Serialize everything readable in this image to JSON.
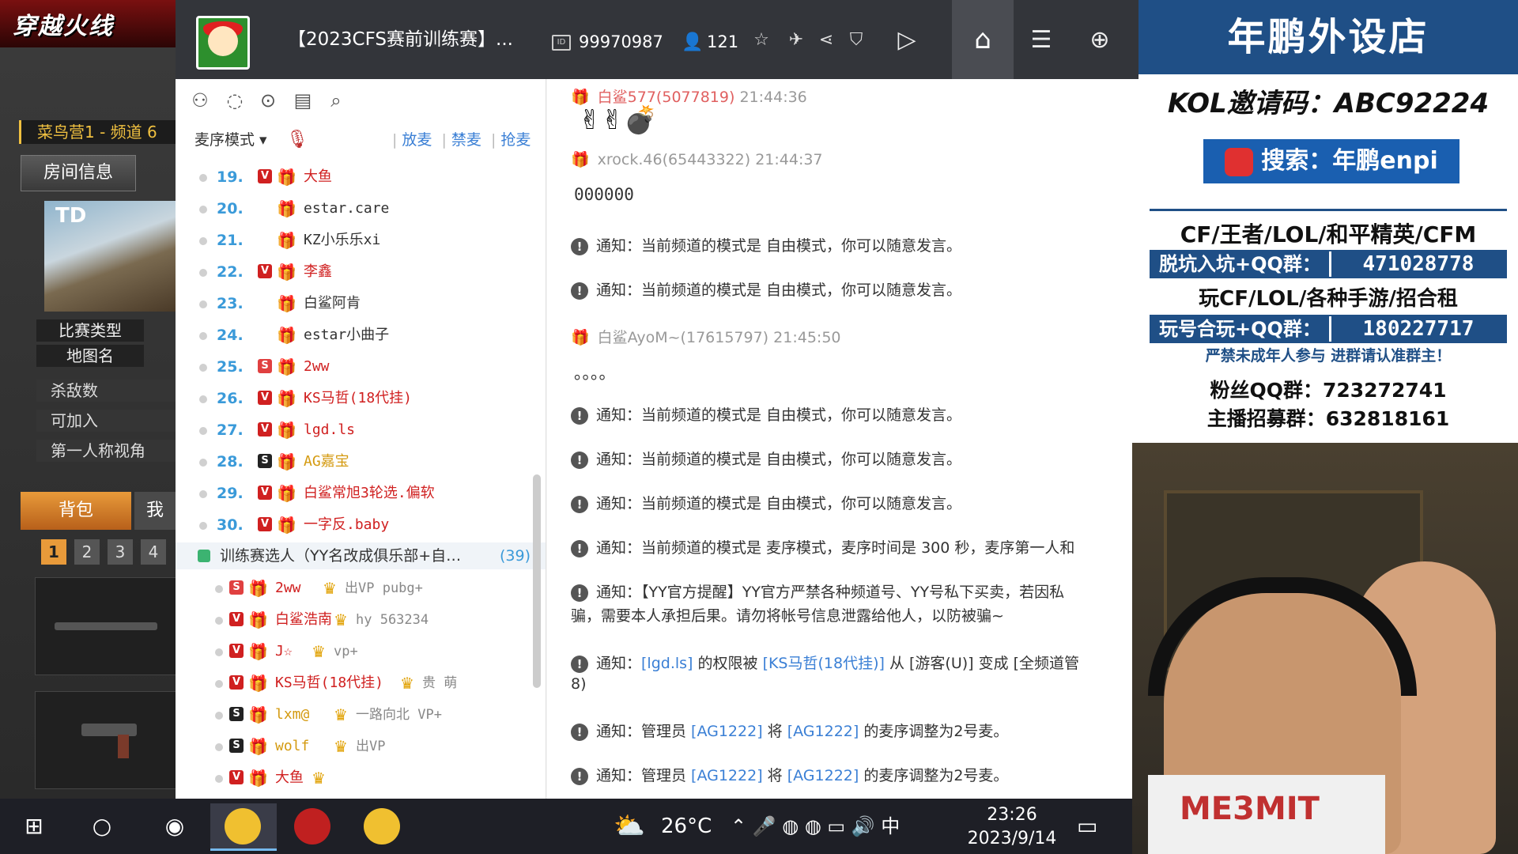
{
  "game": {
    "logo": "穿越火线",
    "channel": "菜鸟营1 - 频道 6",
    "room_info_label": "房间信息",
    "map_code": "TD",
    "match_type_label": "比赛类型",
    "map_name_label": "地图名",
    "kills_label": "杀敌数",
    "joinable_label": "可加入",
    "first_person_label": "第一人称视角",
    "bag_label": "背包",
    "me_label": "我",
    "slots": [
      "1",
      "2",
      "3",
      "4"
    ]
  },
  "yy": {
    "channel_title": "【2023CFS赛前训练赛】...",
    "channel_id": "99970987",
    "online_count": "121",
    "member_panel": {
      "mode_label": "麦序模式",
      "actions": [
        "放麦",
        "禁麦",
        "抢麦"
      ],
      "rows": [
        {
          "num": "19.",
          "badge": "V",
          "badge_color": "#d02020",
          "gift": "gold",
          "name": "大鱼",
          "name_color": "red"
        },
        {
          "num": "20.",
          "badge": "",
          "badge_color": "",
          "gift": "gold",
          "name": "estar.care",
          "name_color": "normal"
        },
        {
          "num": "21.",
          "badge": "",
          "badge_color": "",
          "gift": "gold",
          "name": "KZ小乐乐xi",
          "name_color": "normal"
        },
        {
          "num": "22.",
          "badge": "V",
          "badge_color": "#d02020",
          "gift": "gold",
          "name": "李鑫",
          "name_color": "red"
        },
        {
          "num": "23.",
          "badge": "",
          "badge_color": "",
          "gift": "gold",
          "name": "白鲨阿肯",
          "name_color": "normal"
        },
        {
          "num": "24.",
          "badge": "",
          "badge_color": "",
          "gift": "gold",
          "name": "estar小曲子",
          "name_color": "normal"
        },
        {
          "num": "25.",
          "badge": "S",
          "badge_color": "#e04040",
          "gift": "gold",
          "name": "2ww",
          "name_color": "red"
        },
        {
          "num": "26.",
          "badge": "V",
          "badge_color": "#d02020",
          "gift": "purple",
          "name": "KS马哲(18代挂)",
          "name_color": "red"
        },
        {
          "num": "27.",
          "badge": "V",
          "badge_color": "#d02020",
          "gift": "gold",
          "name": "lgd.ls",
          "name_color": "red"
        },
        {
          "num": "28.",
          "badge": "S",
          "badge_color": "#222222",
          "gift": "gold",
          "name": "AG嘉宝",
          "name_color": "gold"
        },
        {
          "num": "29.",
          "badge": "V",
          "badge_color": "#d02020",
          "gift": "gold",
          "name": "白鲨常旭3轮选.偏软",
          "name_color": "red"
        },
        {
          "num": "30.",
          "badge": "V",
          "badge_color": "#d02020",
          "gift": "gold",
          "name": "一字反.baby",
          "name_color": "red"
        }
      ],
      "group": {
        "name": "训练赛选人（YY名改成俱乐部+自…",
        "count": "(39)"
      },
      "sub_rows": [
        {
          "badge": "S",
          "badge_color": "#e04040",
          "gift": "gold",
          "name": "2ww",
          "name_color": "red",
          "extra": "出VP pubg+"
        },
        {
          "badge": "V",
          "badge_color": "#d02020",
          "gift": "gold",
          "name": "白鲨浩南",
          "name_color": "red",
          "extra": "hy 563234"
        },
        {
          "badge": "V",
          "badge_color": "#d02020",
          "gift": "gold",
          "name": "J☆",
          "name_color": "red",
          "extra": "vp+"
        },
        {
          "badge": "V",
          "badge_color": "#d02020",
          "gift": "purple",
          "name": "KS马哲(18代挂)",
          "name_color": "red",
          "extra": "贵 萌"
        },
        {
          "badge": "S",
          "badge_color": "#222222",
          "gift": "gold",
          "name": "lxm@",
          "name_color": "gold",
          "extra": "一路向北 VP+"
        },
        {
          "badge": "S",
          "badge_color": "#222222",
          "gift": "gold",
          "name": "wolf",
          "name_color": "gold",
          "extra": "出VP"
        },
        {
          "badge": "V",
          "badge_color": "#d02020",
          "gift": "gold",
          "name": "大鱼",
          "name_color": "red",
          "extra": ""
        }
      ]
    },
    "chat": {
      "messages": [
        {
          "type": "sender",
          "name": "白鲨577(5077819)",
          "time": "21:44:36",
          "red": true
        },
        {
          "type": "emoji",
          "text": "✌✌💣"
        },
        {
          "type": "sender",
          "name": "xrock.46(65443322)",
          "time": "21:44:37",
          "red": false
        },
        {
          "type": "body",
          "text": "000000"
        },
        {
          "type": "notice",
          "text": "通知：当前频道的模式是 自由模式，你可以随意发言。"
        },
        {
          "type": "notice",
          "text": "通知：当前频道的模式是 自由模式，你可以随意发言。"
        },
        {
          "type": "sender",
          "name": "白鲨AyoM~(17615797)",
          "time": "21:45:50",
          "red": false
        },
        {
          "type": "body",
          "text": "。。。。"
        },
        {
          "type": "notice",
          "text": "通知：当前频道的模式是 自由模式，你可以随意发言。"
        },
        {
          "type": "notice",
          "text": "通知：当前频道的模式是 自由模式，你可以随意发言。"
        },
        {
          "type": "notice",
          "text": "通知：当前频道的模式是 自由模式，你可以随意发言。"
        },
        {
          "type": "notice",
          "text": "通知：当前频道的模式是 麦序模式，麦序时间是 300 秒，麦序第一人和"
        },
        {
          "type": "notice2",
          "text": "通知：【YY官方提醒】YY官方严禁各种频道号、YY号私下买卖，若因私",
          "text2": "骗，需要本人承担后果。请勿将帐号信息泄露给他人，以防被骗~"
        },
        {
          "type": "notice_link",
          "pre": "通知：",
          "link1": "[lgd.ls]",
          "mid": " 的权限被 ",
          "link2": "[KS马哲(18代挂)]",
          "post": " 从 [游客(U)] 变成 [全频道管",
          "text2": "8)"
        },
        {
          "type": "notice_admin",
          "pre": "通知：管理员 ",
          "link1": "[AG1222]",
          "mid": " 将 ",
          "link2": "[AG1222]",
          "post": " 的麦序调整为2号麦。"
        },
        {
          "type": "notice_admin",
          "pre": "通知：管理员 ",
          "link1": "[AG1222]",
          "mid": " 将 ",
          "link2": "[AG1222]",
          "post": " 的麦序调整为2号麦。"
        }
      ]
    }
  },
  "taskbar": {
    "temperature": "26°C",
    "ime": "中",
    "time": "23:26",
    "date": "2023/9/14"
  },
  "overlay": {
    "shop_name": "年鹏外设店",
    "kol_code": "KOL邀请码：ABC92224",
    "search": "搜索：年鹏enpi",
    "games_line": "CF/王者/LOL/和平精英/CFM",
    "box1_label": "脱坑入坑+QQ群：",
    "box1_value": "471028778",
    "rent_line": "玩CF/LOL/各种手游/招合租",
    "box2_label": "玩号合玩+QQ群：",
    "box2_value": "180227717",
    "warning": "严禁未成年人参与  进群请认准群主！",
    "fans_group": "粉丝QQ群：723272741",
    "recruit_group": "主播招募群：632818161",
    "shirt_text": "ME3MIT"
  },
  "colors": {
    "yy_topbar": "#33353a",
    "link_blue": "#3a7fd5",
    "overlay_blue": "#1f4f86",
    "vip_red": "#d02020"
  }
}
